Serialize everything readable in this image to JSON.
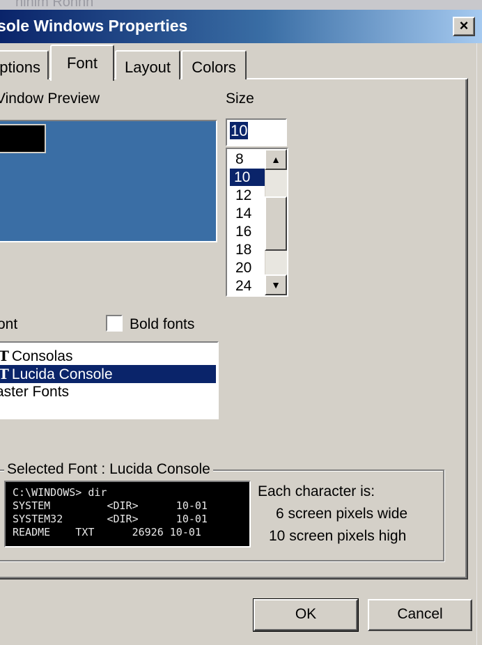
{
  "window": {
    "top_strip_text": "ninim Ronnn",
    "title": "sole Windows Properties",
    "close_glyph": "×"
  },
  "tabs": [
    {
      "label": "ptions",
      "active": false
    },
    {
      "label": "Font",
      "active": true
    },
    {
      "label": "Layout",
      "active": false
    },
    {
      "label": "Colors",
      "active": false
    }
  ],
  "preview": {
    "label": "Vindow Preview",
    "background_color": "#3a6ea5"
  },
  "size": {
    "label": "Size",
    "value": "10",
    "options": [
      "8",
      "10",
      "12",
      "14",
      "16",
      "18",
      "20",
      "24"
    ],
    "selected": "10"
  },
  "font": {
    "label": "ont",
    "bold_label": "Bold fonts",
    "bold_checked": false,
    "items": [
      {
        "icon": "truetype-icon",
        "name": "Consolas",
        "selected": false
      },
      {
        "icon": "truetype-icon",
        "name": "Lucida Console",
        "selected": true
      },
      {
        "icon": "",
        "name": "aster Fonts",
        "selected": false
      }
    ]
  },
  "selected_font": {
    "title": "Selected Font : Lucida Console",
    "sample_lines": [
      "C:\\WINDOWS> dir",
      "SYSTEM         <DIR>      10-01",
      "SYSTEM32       <DIR>      10-01",
      "README    TXT      26926 10-01"
    ],
    "char_heading": "Each character is:",
    "char_width": "6 screen pixels wide",
    "char_height": "10 screen pixels high"
  },
  "buttons": {
    "ok": "OK",
    "cancel": "Cancel"
  },
  "colors": {
    "titlebar_start": "#0a246a",
    "titlebar_end": "#a6caf0",
    "selection": "#0a246a",
    "dialog": "#d4d0c8"
  }
}
